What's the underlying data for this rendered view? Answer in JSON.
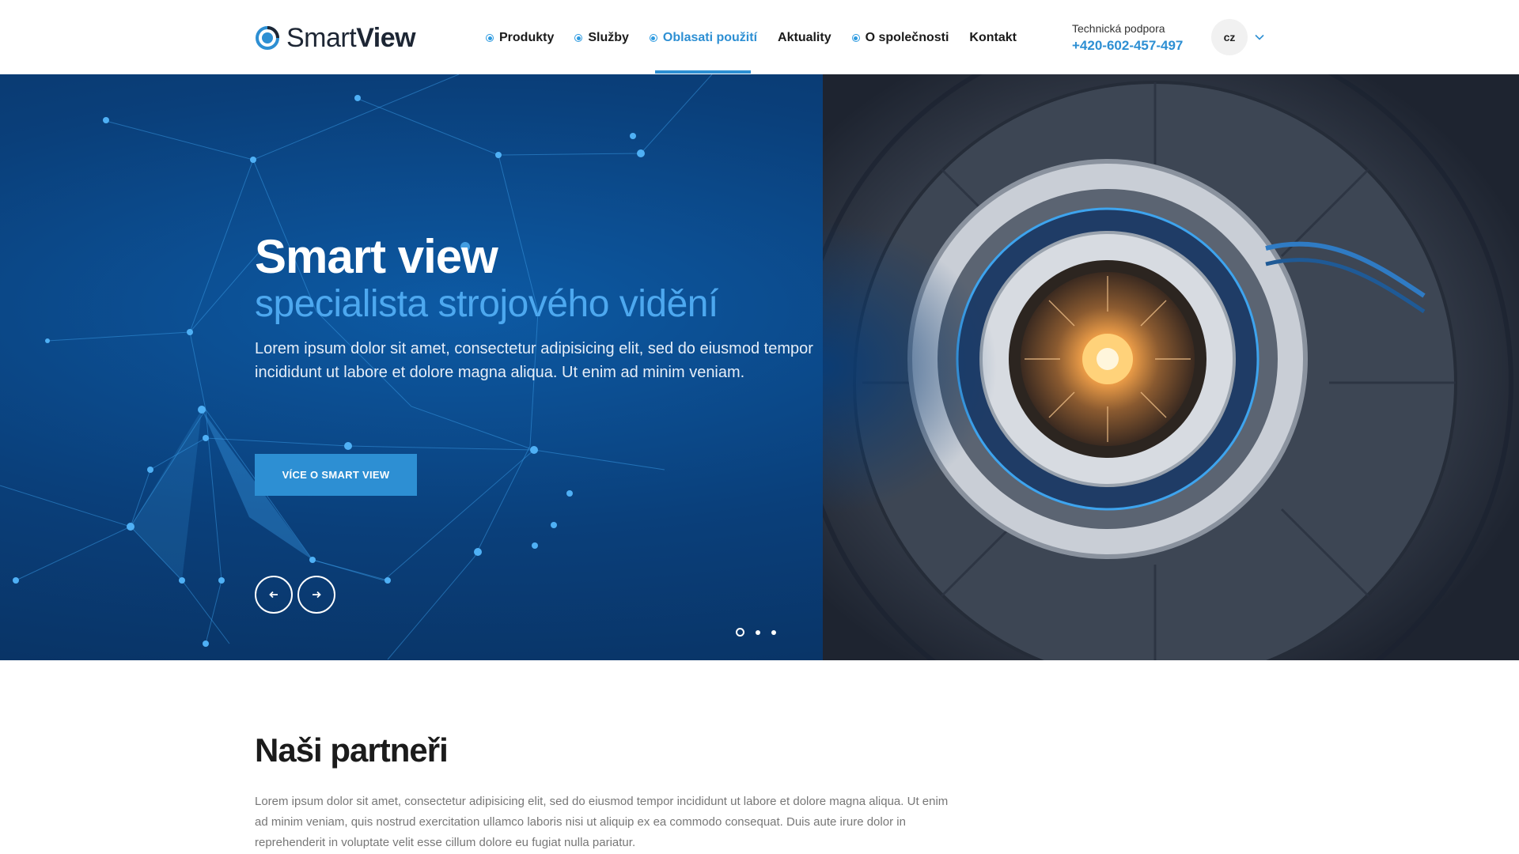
{
  "header": {
    "logo": {
      "prefix": "Smart",
      "bold": "View"
    },
    "nav": [
      {
        "label": "Produkty",
        "has_dot": true,
        "active": false
      },
      {
        "label": "Služby",
        "has_dot": true,
        "active": false
      },
      {
        "label": "Oblasati použití",
        "has_dot": true,
        "active": true
      },
      {
        "label": "Aktuality",
        "has_dot": false,
        "active": false
      },
      {
        "label": "O společnosti",
        "has_dot": true,
        "active": false
      },
      {
        "label": "Kontakt",
        "has_dot": false,
        "active": false
      }
    ],
    "support_label": "Technická podpora",
    "support_phone": "+420-602-457-497",
    "language": "cz"
  },
  "hero": {
    "title": "Smart view",
    "subtitle": "specialista strojového vidění",
    "text": "Lorem ipsum dolor sit amet, consectetur adipisicing elit, sed do eiusmod tempor incididunt ut labore et dolore magna aliqua. Ut enim ad minim veniam.",
    "button_label": "VÍCE O SMART VIEW",
    "slide_count": 3,
    "active_slide": 0
  },
  "partners": {
    "title": "Naši partneři",
    "text": "Lorem ipsum dolor sit amet, consectetur adipisicing elit, sed do eiusmod tempor incididunt ut labore et dolore magna aliqua. Ut enim ad minim veniam, quis nostrud exercitation ullamco laboris nisi ut aliquip ex ea commodo consequat. Duis aute irure dolor in reprehenderit in voluptate velit esse cillum dolore eu fugiat nulla pariatur."
  },
  "colors": {
    "accent": "#2d8fd3",
    "hero_dark": "#082c58",
    "hero_mid": "#0d5aa4",
    "subtitle": "#4da8ef"
  },
  "icons": {
    "logo": "ring-logo-icon",
    "nav_dot": "nav-dot-icon",
    "chevron": "chevron-down-icon",
    "prev": "arrow-left-icon",
    "next": "arrow-right-icon"
  }
}
